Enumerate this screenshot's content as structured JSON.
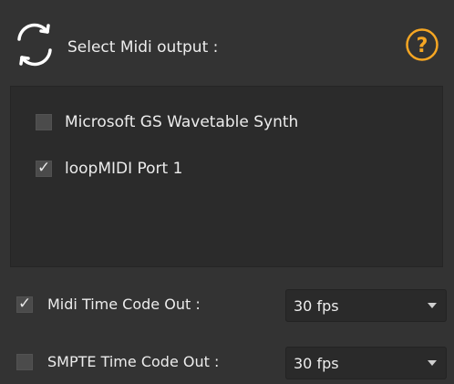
{
  "header": {
    "title": "Select Midi output :",
    "refresh_icon": "refresh-icon",
    "help_icon": "help-icon",
    "help_symbol": "?",
    "help_color": "#f5a623"
  },
  "devices": [
    {
      "label": "Microsoft GS Wavetable Synth",
      "checked": false
    },
    {
      "label": "loopMIDI Port 1",
      "checked": true
    }
  ],
  "options": {
    "mtc": {
      "label": "Midi Time Code Out :",
      "checked": true,
      "value": "30 fps"
    },
    "smpte": {
      "label": "SMPTE Time Code Out :",
      "checked": false,
      "value": "30 fps"
    }
  },
  "check_mark": "✓"
}
